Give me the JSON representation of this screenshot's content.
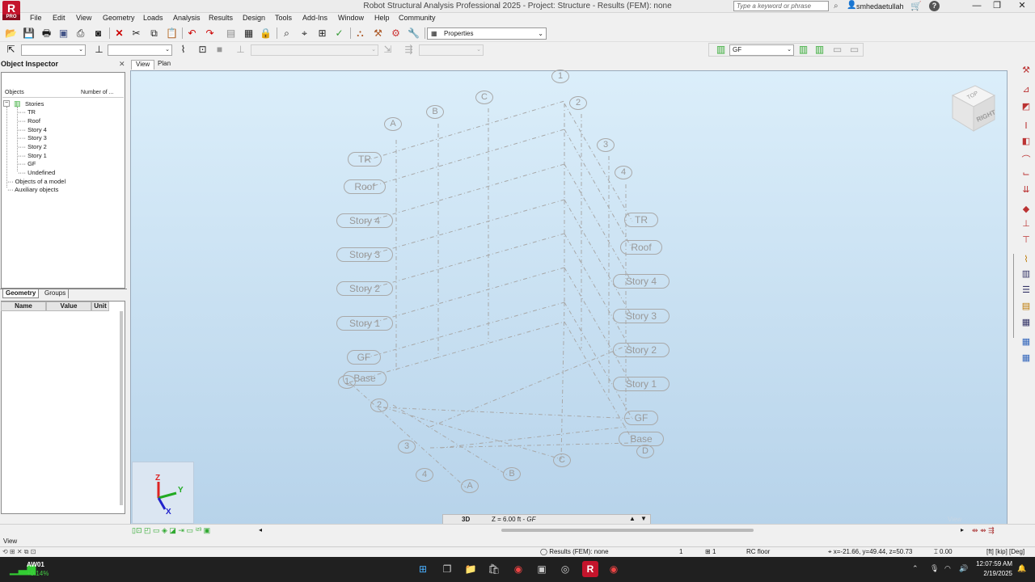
{
  "app": {
    "logo_letter": "R",
    "logo_sub": "PRO",
    "title": "Robot Structural Analysis Professional 2025 - Project: Structure - Results (FEM): none",
    "search_placeholder": "Type a keyword or phrase",
    "user": "smhedaetullah",
    "window_controls": [
      "—",
      "❐",
      "✕"
    ]
  },
  "menu": [
    "File",
    "Edit",
    "View",
    "Geometry",
    "Loads",
    "Analysis",
    "Results",
    "Design",
    "Tools",
    "Add-Ins",
    "Window",
    "Help",
    "Community"
  ],
  "toolbar": {
    "properties_label": "Properties",
    "story_selector": "GF"
  },
  "inspector": {
    "title": "Object Inspector",
    "col_objects": "Objects",
    "col_number": "Number of ...",
    "tree": {
      "root": "Stories",
      "stories": [
        "TR",
        "Roof",
        "Story 4",
        "Story 3",
        "Story 2",
        "Story 1",
        "GF",
        "Undefined"
      ],
      "extra": [
        "Objects of a model",
        "Auxiliary objects"
      ]
    },
    "tabs": [
      "Geometry",
      "Groups"
    ],
    "prop_headers": [
      "Name",
      "Value",
      "Unit"
    ]
  },
  "view_tabs": [
    "View",
    "Plan"
  ],
  "viewport": {
    "view_cube_top": "TOP",
    "view_cube_right": "RIGHT",
    "axis_labels": {
      "x": "X",
      "y": "Y",
      "z": "Z"
    },
    "grid_labels_left": [
      "A",
      "B",
      "C"
    ],
    "grid_labels_top": [
      "1",
      "2",
      "3",
      "4"
    ],
    "left_story_labels": [
      "TR",
      "Roof",
      "Story 4",
      "Story 3",
      "Story 2",
      "Story 1",
      "GF",
      "Base"
    ],
    "right_story_labels": [
      "TR",
      "Roof",
      "Story 4",
      "Story 3",
      "Story 2",
      "Story 1",
      "GF",
      "Base"
    ],
    "bottom_labels_num": [
      "1",
      "2",
      "3",
      "4"
    ],
    "bottom_labels_alpha": [
      "A",
      "B",
      "C",
      "D"
    ],
    "bottom_bar_mode": "3D",
    "bottom_bar_level": "Z = 6.00 ft - ",
    "bottom_bar_level_name": "GF",
    "watermark": "View"
  },
  "status": {
    "view_label": "View",
    "results": "Results (FEM): none",
    "count1": "1",
    "count2": "1",
    "section": "RC floor",
    "coords": "x=-21.66, y=49.44, z=50.73",
    "value": "0.00",
    "units": "[ft] [kip] [Deg]"
  },
  "taskbar": {
    "weather_title": "AW01",
    "weather_value": "+0.14%",
    "time": "12:07:59 AM",
    "date": "2/19/2025"
  }
}
